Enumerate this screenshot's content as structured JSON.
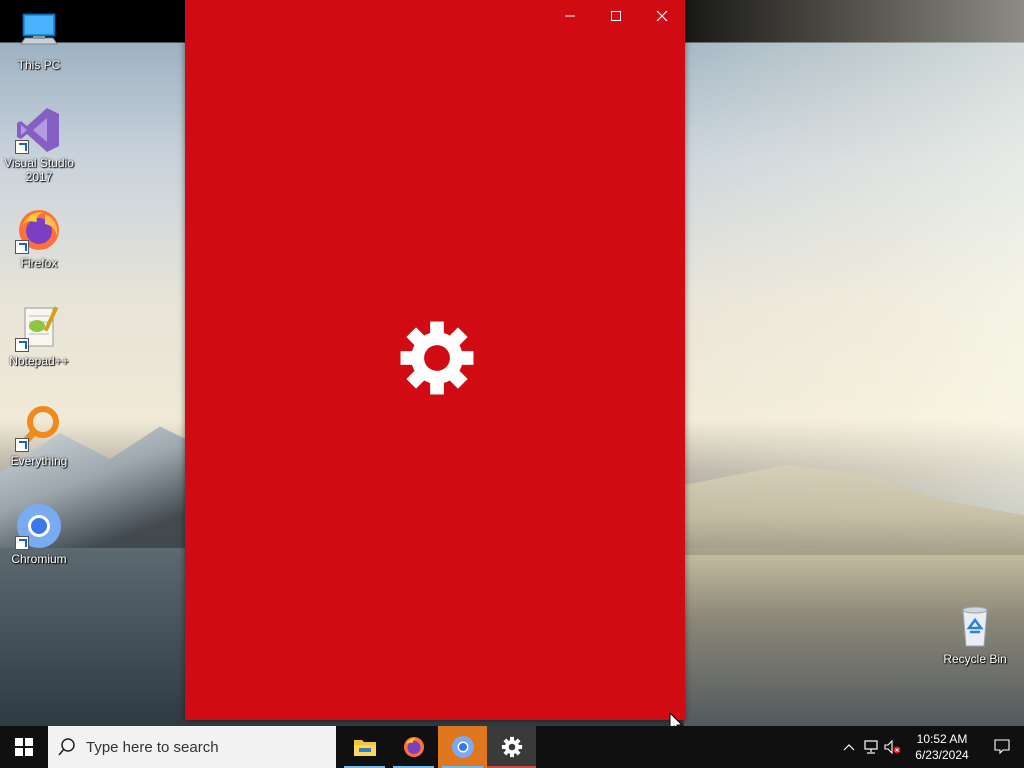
{
  "desktop": {
    "icons": [
      {
        "label": "This PC",
        "icon": "computer-icon"
      },
      {
        "label": "Visual Studio\n2017",
        "icon": "visual-studio-icon"
      },
      {
        "label": "Firefox",
        "icon": "firefox-icon"
      },
      {
        "label": "Notepad++",
        "icon": "notepad-plus-plus-icon"
      },
      {
        "label": "Everything",
        "icon": "everything-search-icon"
      },
      {
        "label": "Chromium",
        "icon": "chromium-icon"
      },
      {
        "label": "Recycle Bin",
        "icon": "recycle-bin-icon"
      }
    ]
  },
  "window": {
    "background_color": "#d00b13",
    "controls": [
      "minimize-icon",
      "maximize-icon",
      "close-icon"
    ],
    "content_icon": "gear-icon"
  },
  "taskbar": {
    "search_placeholder": "Type here to search",
    "pinned": [
      "file-explorer-icon",
      "firefox-icon",
      "chromium-icon",
      "settings-gear-icon"
    ],
    "tray_icons": [
      "chevron-up-icon",
      "network-icon",
      "volume-muted-icon"
    ],
    "clock_time": "10:52 AM",
    "clock_date": "6/23/2024",
    "notification_icon": "action-center-icon"
  },
  "colors": {
    "taskbar": "#101010",
    "chromium_highlight": "#e0761e",
    "active_indicator": "#76b9ed"
  }
}
